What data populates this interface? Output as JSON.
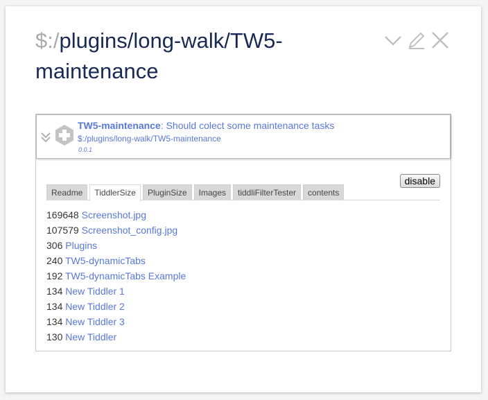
{
  "tiddler": {
    "title_prefix": "$:/",
    "title_rest": "plugins/long-walk/TW5-maintenance"
  },
  "controls": [
    {
      "name": "more-actions",
      "icon": "chevron-down-icon"
    },
    {
      "name": "edit",
      "icon": "pencil-icon"
    },
    {
      "name": "close",
      "icon": "close-icon"
    }
  ],
  "plugin": {
    "name": "TW5-maintenance",
    "description": ": Should colect some maintenance tasks",
    "path": "$:/plugins/long-walk/TW5-maintenance",
    "version": "0.0.1",
    "disable_label": "disable"
  },
  "tabs": [
    {
      "label": "Readme",
      "active": false
    },
    {
      "label": "TiddlerSize",
      "active": true
    },
    {
      "label": "PluginSize",
      "active": false
    },
    {
      "label": "Images",
      "active": false
    },
    {
      "label": "tiddliFilterTester",
      "active": false
    },
    {
      "label": "contents",
      "active": false
    }
  ],
  "sizes": [
    {
      "size": "169648",
      "name": "Screenshot.jpg"
    },
    {
      "size": "107579",
      "name": "Screenshot_config.jpg"
    },
    {
      "size": "306",
      "name": "Plugins"
    },
    {
      "size": "240",
      "name": "TW5-dynamicTabs"
    },
    {
      "size": "192",
      "name": "TW5-dynamicTabs Example"
    },
    {
      "size": "134",
      "name": "New Tiddler 1"
    },
    {
      "size": "134",
      "name": "New Tiddler 2"
    },
    {
      "size": "134",
      "name": "New Tiddler 3"
    },
    {
      "size": "130",
      "name": "New Tiddler"
    }
  ],
  "colors": {
    "title": "#182955",
    "link": "#5778d8",
    "prefix": "#aaaaaa",
    "icon": "#c0c0c0"
  }
}
